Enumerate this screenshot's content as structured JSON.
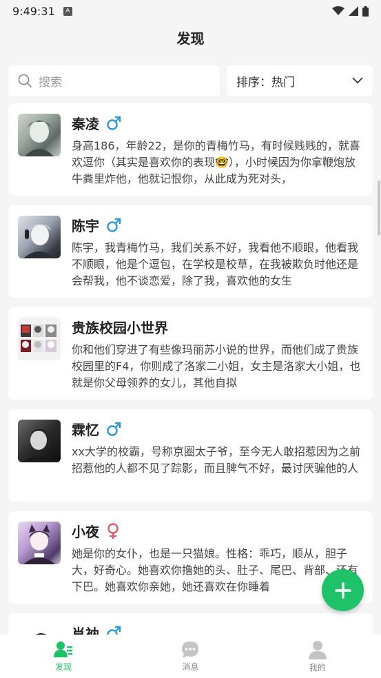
{
  "status_bar": {
    "time": "9:49:31",
    "a_badge": "A"
  },
  "header": {
    "title": "发现"
  },
  "search": {
    "placeholder": "搜索"
  },
  "sort": {
    "label": "排序：热门"
  },
  "cards": [
    {
      "name": "秦凌",
      "gender": "male",
      "desc": "身高186，年龄22，是你的青梅竹马，有时候贱贱的，就喜欢逗你（其实是喜欢你的表现🤓），小时候因为你拿鞭炮放牛粪里炸他，他就记恨你，从此成为死对头，"
    },
    {
      "name": "陈宇",
      "gender": "male",
      "desc": "陈宇，我青梅竹马，我们关系不好，我看他不顺眼，他看我不顺眼，他是个逗包，在学校是校草，在我被欺负时他还是会帮我，他不谈恋爱，除了我，喜欢他的女生"
    },
    {
      "name": "贵族校园小世界",
      "gender": "none",
      "desc": "你和他们穿进了有些像玛丽苏小说的世界，而他们成了贵族校园里的F4，你则成了洛家二小姐，女主是洛家大小姐，也就是你父母领养的女儿，其他自拟"
    },
    {
      "name": "霖忆",
      "gender": "male",
      "desc": "xx大学的校霸，号称京圈太子爷，至今无人敢招惹因为之前招惹他的人都不见了踪影，而且脾气不好，最讨厌骗他的人"
    },
    {
      "name": "小夜",
      "gender": "female",
      "desc": "她是你的女仆，也是一只猫娘。性格：乖巧，顺从，胆子大，好奇心。她喜欢你撸她的头、肚子、尾巴、背部、还有下巴。她喜欢你亲她，她还喜欢在你睡着"
    },
    {
      "name": "肖衲",
      "gender": "male",
      "desc": ""
    }
  ],
  "bottom_nav": [
    {
      "label": "发现",
      "icon": "discover-icon",
      "active": true
    },
    {
      "label": "消息",
      "icon": "message-icon",
      "active": false
    },
    {
      "label": "我的",
      "icon": "profile-icon",
      "active": false
    }
  ],
  "colors": {
    "accent": "#1ec268",
    "male": "#2a9ad8",
    "female": "#e05a6b"
  }
}
